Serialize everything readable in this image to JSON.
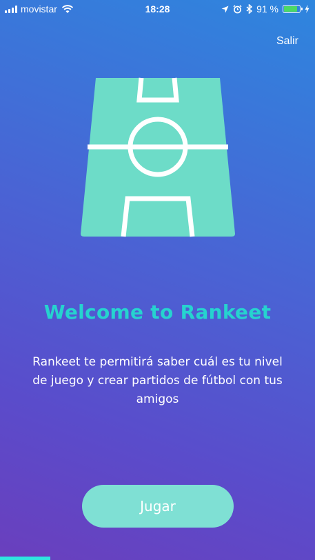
{
  "status_bar": {
    "carrier": "movistar",
    "time": "18:28",
    "battery_percent": "91 %",
    "battery_level": 0.91
  },
  "header": {
    "exit_label": "Salir"
  },
  "main": {
    "title": "Welcome to Rankeet",
    "description": "Rankeet te permitirá saber cuál es tu nivel de juego y crear partidos de fútbol con tus amigos"
  },
  "actions": {
    "play_label": "Jugar"
  },
  "onboarding": {
    "progress": 0.16
  },
  "colors": {
    "accent": "#26d3cf",
    "pitch": "#6ddcc8",
    "button": "#7fe0d4",
    "progress": "#2ee6e0"
  },
  "icons": [
    "signal-icon",
    "wifi-icon",
    "location-icon",
    "alarm-icon",
    "bluetooth-icon",
    "battery-icon",
    "charging-icon",
    "football-pitch-icon"
  ]
}
